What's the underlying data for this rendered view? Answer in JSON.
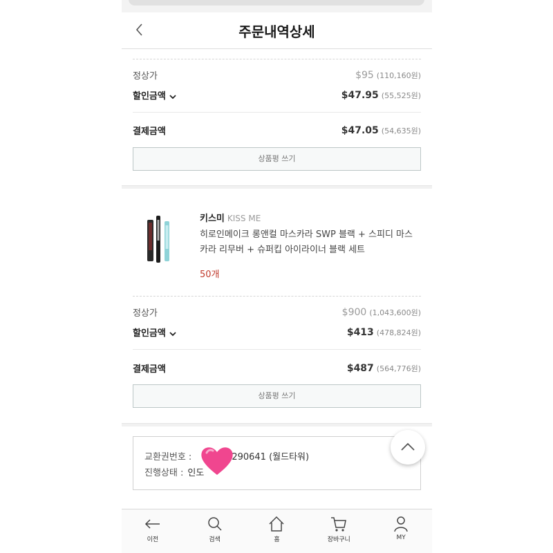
{
  "header": {
    "title": "주문내역상세"
  },
  "order1": {
    "regular_price_label": "정상가",
    "regular_price_usd": "$95",
    "regular_price_krw": "(110,160원)",
    "discount_label": "할인금액",
    "discount_usd": "$47.95",
    "discount_krw": "(55,525원)",
    "payment_label": "결제금액",
    "payment_usd": "$47.05",
    "payment_krw": "(54,635원)",
    "review_button": "상품평 쓰기"
  },
  "product2": {
    "brand_ko": "키스미",
    "brand_en": "KISS ME",
    "name": "히로인메이크 롱앤컬 마스카라 SWP 블랙 + 스피디 마스카라 리무버 + 슈퍼킵 아이라이너 블랙 세트",
    "quantity": "50개",
    "regular_price_label": "정상가",
    "regular_price_usd": "$900",
    "regular_price_krw": "(1,043,600원)",
    "discount_label": "할인금액",
    "discount_usd": "$413",
    "discount_krw": "(478,824원)",
    "payment_label": "결제금액",
    "payment_usd": "$487",
    "payment_krw": "(564,776원)",
    "review_button": "상품평 쓰기"
  },
  "exchange": {
    "voucher_label": "교환권번호 :",
    "voucher_value": "290641 (월드타워)",
    "status_label": "진행상태 :",
    "status_value": "인도"
  },
  "tabbar": {
    "items": [
      {
        "label": "이전",
        "icon": "back-arrow-icon"
      },
      {
        "label": "검색",
        "icon": "search-icon"
      },
      {
        "label": "홈",
        "icon": "home-icon"
      },
      {
        "label": "장바구니",
        "icon": "cart-icon"
      },
      {
        "label": "MY",
        "icon": "user-icon"
      }
    ]
  },
  "colors": {
    "quantity": "#c0392b",
    "heart": "#f0468f",
    "review_border": "#bcc6c6"
  }
}
